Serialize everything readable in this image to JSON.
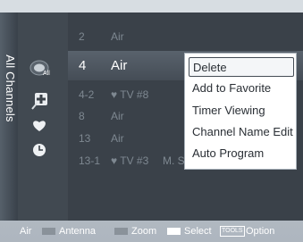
{
  "title": "All Channels",
  "channels": [
    {
      "number": "2",
      "name": "Air",
      "program": ""
    },
    {
      "number": "4",
      "name": "Air",
      "program": "",
      "selected": true
    },
    {
      "number": "4-2",
      "name": "♥ TV #8",
      "program": ""
    },
    {
      "number": "8",
      "name": "Air",
      "program": ""
    },
    {
      "number": "13",
      "name": "Air",
      "program": ""
    },
    {
      "number": "13-1",
      "name": "♥ TV #3",
      "program": "M. Sp..."
    }
  ],
  "context_menu": {
    "items": [
      "Delete",
      "Add to Favorite",
      "Timer Viewing",
      "Channel Name Edit",
      "Auto Program"
    ],
    "active": "Delete"
  },
  "icons": [
    "air-icon",
    "add-icon",
    "favorite-heart-icon",
    "timer-clock-icon"
  ],
  "footer": {
    "source": "Air",
    "antenna": "Antenna",
    "zoom": "Zoom",
    "select": "Select",
    "tools": "TOOLS",
    "option": "Option"
  },
  "colors": {
    "selected_row": "#59626c",
    "menu_bg": "#ffffff",
    "button_gray": "#8a929a",
    "button_white": "#ffffff"
  }
}
